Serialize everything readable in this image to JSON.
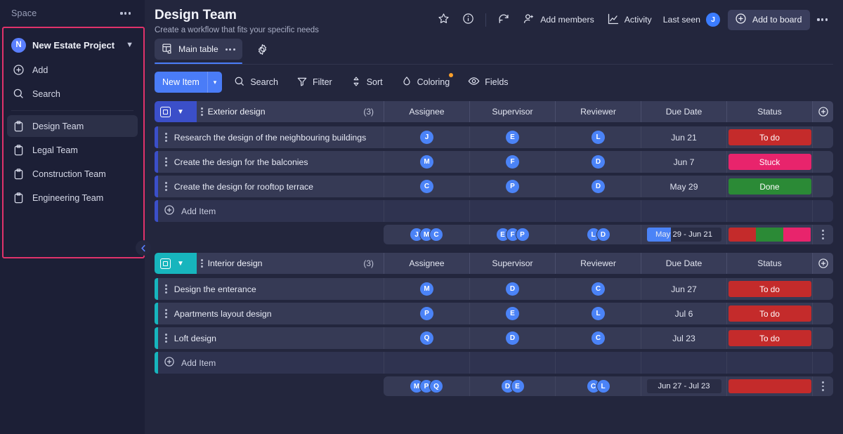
{
  "sidebar": {
    "space_label": "Space",
    "project": {
      "badge": "N",
      "name": "New Estate Project"
    },
    "actions": [
      {
        "label": "Add",
        "icon": "plus-circle-icon"
      },
      {
        "label": "Search",
        "icon": "search-icon"
      }
    ],
    "items": [
      {
        "label": "Design Team",
        "icon": "clipboard-icon",
        "selected": true
      },
      {
        "label": "Legal Team",
        "icon": "clipboard-icon",
        "selected": false
      },
      {
        "label": "Construction Team",
        "icon": "clipboard-icon",
        "selected": false
      },
      {
        "label": "Engineering Team",
        "icon": "clipboard-icon",
        "selected": false
      }
    ],
    "highlight_color": "#e0326a"
  },
  "header": {
    "title": "Design Team",
    "subtitle": "Create a workflow that fits your specific needs",
    "actions": {
      "favorite_icon": "star-icon",
      "info_icon": "info-circle-icon",
      "activity_log_icon": "refresh-history-icon",
      "add_members_label": "Add members",
      "add_members_icon": "person-plus-icon",
      "activity_label": "Activity",
      "activity_icon": "chart-line-icon",
      "last_seen_label": "Last seen",
      "last_seen_avatar": "J",
      "add_to_board_label": "Add to board",
      "add_to_board_icon": "plus-circle-icon",
      "more_icon": "dots-horizontal-icon"
    }
  },
  "tabs": {
    "main_table_label": "Main table",
    "main_table_icon": "table-home-icon",
    "tab_more_icon": "dots-horizontal-icon",
    "settings_icon": "gear-icon"
  },
  "toolbar": {
    "new_item_label": "New Item",
    "new_item_arrow": "▾",
    "buttons": [
      {
        "label": "Search",
        "icon": "search-icon",
        "badge": false
      },
      {
        "label": "Filter",
        "icon": "filter-icon",
        "badge": false
      },
      {
        "label": "Sort",
        "icon": "sort-icon",
        "badge": false
      },
      {
        "label": "Coloring",
        "icon": "droplet-icon",
        "badge": true
      },
      {
        "label": "Fields",
        "icon": "eye-icon",
        "badge": false
      }
    ],
    "badge_color": "#fa9f2a"
  },
  "table": {
    "columns": [
      "Assignee",
      "Supervisor",
      "Reviewer",
      "Due Date",
      "Status"
    ],
    "add_column_icon": "plus-circle-icon",
    "add_item_label": "Add Item",
    "groups": [
      {
        "name": "Exterior design",
        "count": "(3)",
        "color": "#3b4fc9",
        "rows": [
          {
            "title": "Research the design of the neighbouring buildings",
            "assignee": "J",
            "supervisor": "E",
            "reviewer": "L",
            "due_date": "Jun 21",
            "status": "To do",
            "status_color": "#c42b2b"
          },
          {
            "title": "Create the design for the balconies",
            "assignee": "M",
            "supervisor": "F",
            "reviewer": "D",
            "due_date": "Jun 7",
            "status": "Stuck",
            "status_color": "#e8246c"
          },
          {
            "title": "Create the design for rooftop terrace",
            "assignee": "C",
            "supervisor": "P",
            "reviewer": "D",
            "due_date": "May 29",
            "status": "Done",
            "status_color": "#2b8a36"
          }
        ],
        "summary": {
          "assignees": [
            "J",
            "M",
            "C"
          ],
          "supervisors": [
            "E",
            "F",
            "P"
          ],
          "reviewers": [
            "L",
            "D"
          ],
          "date_range": "May 29 - Jun 21",
          "date_fill_pct": 33,
          "status_segments": [
            {
              "color": "#c42b2b",
              "pct": 33.3
            },
            {
              "color": "#2b8a36",
              "pct": 33.3
            },
            {
              "color": "#e8246c",
              "pct": 33.4
            }
          ]
        }
      },
      {
        "name": "Interior design",
        "count": "(3)",
        "color": "#17b5bd",
        "rows": [
          {
            "title": "Design the enterance",
            "assignee": "M",
            "supervisor": "D",
            "reviewer": "C",
            "due_date": "Jun 27",
            "status": "To do",
            "status_color": "#c42b2b"
          },
          {
            "title": "Apartments layout design",
            "assignee": "P",
            "supervisor": "E",
            "reviewer": "L",
            "due_date": "Jul 6",
            "status": "To do",
            "status_color": "#c42b2b"
          },
          {
            "title": "Loft design",
            "assignee": "Q",
            "supervisor": "D",
            "reviewer": "C",
            "due_date": "Jul 23",
            "status": "To do",
            "status_color": "#c42b2b"
          }
        ],
        "summary": {
          "assignees": [
            "M",
            "P",
            "Q"
          ],
          "supervisors": [
            "D",
            "E"
          ],
          "reviewers": [
            "C",
            "L"
          ],
          "date_range": "Jun 27 - Jul 23",
          "date_fill_pct": 0,
          "status_segments": [
            {
              "color": "#c42b2b",
              "pct": 100
            }
          ]
        }
      }
    ]
  }
}
